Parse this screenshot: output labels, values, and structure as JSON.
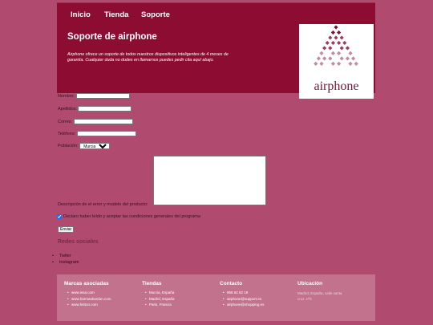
{
  "nav": {
    "items": [
      {
        "label": "Inicio"
      },
      {
        "label": "Tienda"
      },
      {
        "label": "Soporte"
      }
    ]
  },
  "hero": {
    "title": "Soporte de airphone",
    "description": "Airphone ofrece un soporte de todos nuestros dispositivos inteligentes de 4 meses de garantía. Cualquier duda no dudes en llamarnos puedes pedir cita aquí abajo."
  },
  "logo": {
    "text": "airphone",
    "color": "#7a1436"
  },
  "form": {
    "nombre_label": "Nombre:",
    "apellidos_label": "Apellidos:",
    "correo_label": "Correo:",
    "telefono_label": "Teléfono:",
    "poblacion_label": "Población:",
    "poblacion_value": "Murcia",
    "descripcion_label": "Descripción de el error y modelo del producto:",
    "terms_label": "Declaro haber leído y aceptar las condiciones generales del programa",
    "terms_checked": true,
    "submit_label": "Enviar"
  },
  "social": {
    "title": "Redes sociales",
    "items": [
      "Twiter",
      "Instagram"
    ]
  },
  "footer": {
    "marcas": {
      "title": "Marcas asociadas",
      "items": [
        "www.iesa.com",
        "www.harmankardon.com",
        "www.feitton.com"
      ]
    },
    "tiendas": {
      "title": "Tiendas",
      "items": [
        "Murcia, España",
        "Madrid, España",
        "Paris, Francia"
      ]
    },
    "contacto": {
      "title": "Contacto",
      "items": [
        "968 62 62 19",
        "airphone@support.es",
        "airphone@shopping.es"
      ]
    },
    "ubicacion": {
      "title": "Ubicación",
      "text": "Madrid, España, calle santa cruz, nº6"
    }
  },
  "colors": {
    "background": "#b04a6e",
    "header": "#8c0d31",
    "footer": "#c2728c"
  }
}
